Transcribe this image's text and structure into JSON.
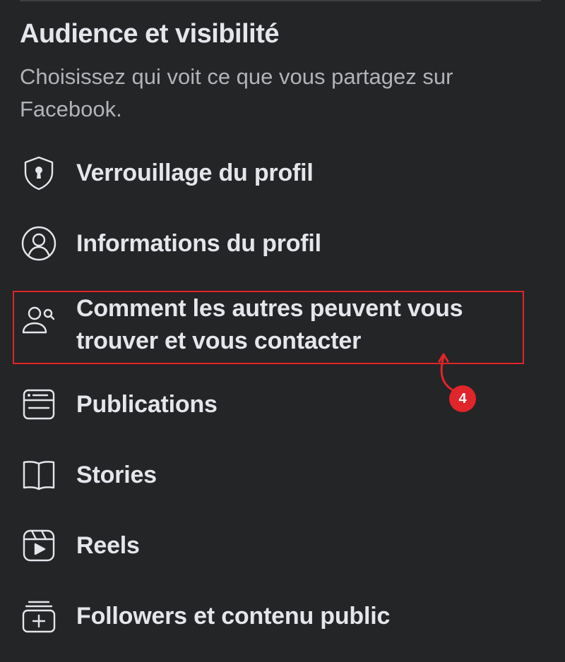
{
  "section": {
    "title": "Audience et visibilité",
    "description": "Choisissez qui voit ce que vous partagez sur Facebook."
  },
  "menu": {
    "items": [
      {
        "label": "Verrouillage du profil",
        "icon": "shield-lock-icon"
      },
      {
        "label": "Informations du profil",
        "icon": "profile-circle-icon"
      },
      {
        "label": "Comment les autres peuvent vous trouver et vous contacter",
        "icon": "person-search-icon",
        "highlighted": true
      },
      {
        "label": "Publications",
        "icon": "posts-icon"
      },
      {
        "label": "Stories",
        "icon": "book-icon"
      },
      {
        "label": "Reels",
        "icon": "reels-icon"
      },
      {
        "label": "Followers et contenu public",
        "icon": "stack-plus-icon"
      }
    ]
  },
  "annotation": {
    "step_number": "4",
    "color": "#e0252b"
  },
  "theme": {
    "background": "#242526",
    "text_primary": "#e4e6eb",
    "text_secondary": "#b0b3b8"
  }
}
